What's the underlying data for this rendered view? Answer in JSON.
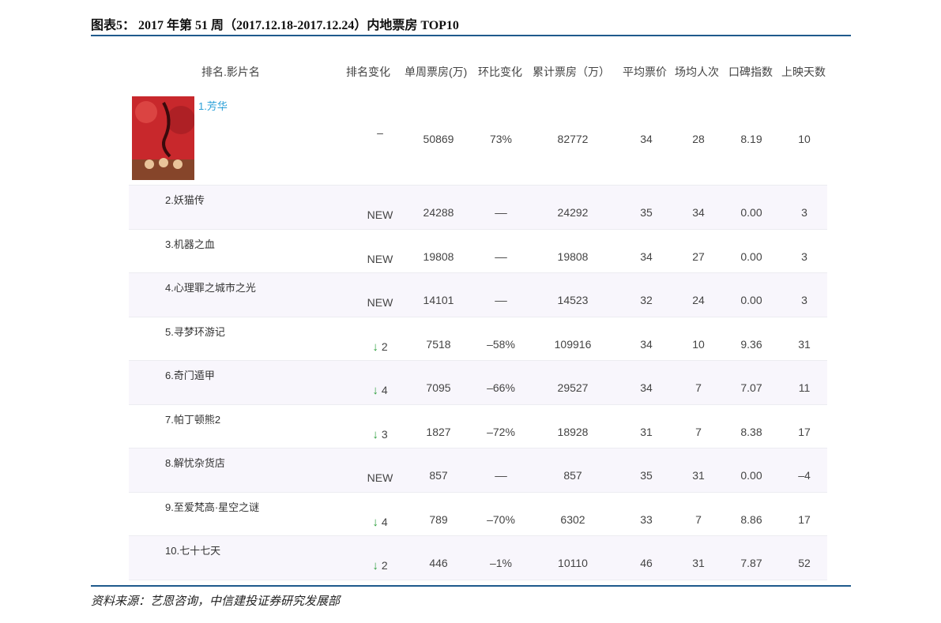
{
  "figure": {
    "title": "图表5：  2017 年第 51 周（2017.12.18-2017.12.24）内地票房 TOP10",
    "source": "资料来源：艺恩咨询，中信建投证券研究发展部"
  },
  "table": {
    "headers": [
      "排名.影片名",
      "排名变化",
      "单周票房(万)",
      "环比变化",
      "累计票房（万）",
      "平均票价",
      "场均人次",
      "口碑指数",
      "上映天数"
    ],
    "rows": [
      {
        "name": "1.芳华",
        "change": "–",
        "change_dir": "",
        "weekly": "50869",
        "wow": "73%",
        "total": "82772",
        "price": "34",
        "per_show": "28",
        "rating": "8.19",
        "days": "10"
      },
      {
        "name": "2.妖猫传",
        "change": "NEW",
        "change_dir": "",
        "weekly": "24288",
        "wow": "––",
        "total": "24292",
        "price": "35",
        "per_show": "34",
        "rating": "0.00",
        "days": "3"
      },
      {
        "name": "3.机器之血",
        "change": "NEW",
        "change_dir": "",
        "weekly": "19808",
        "wow": "––",
        "total": "19808",
        "price": "34",
        "per_show": "27",
        "rating": "0.00",
        "days": "3"
      },
      {
        "name": "4.心理罪之城市之光",
        "change": "NEW",
        "change_dir": "",
        "weekly": "14101",
        "wow": "––",
        "total": "14523",
        "price": "32",
        "per_show": "24",
        "rating": "0.00",
        "days": "3"
      },
      {
        "name": "5.寻梦环游记",
        "change": "2",
        "change_dir": "down",
        "weekly": "7518",
        "wow": "–58%",
        "total": "109916",
        "price": "34",
        "per_show": "10",
        "rating": "9.36",
        "days": "31"
      },
      {
        "name": "6.奇门遁甲",
        "change": "4",
        "change_dir": "down",
        "weekly": "7095",
        "wow": "–66%",
        "total": "29527",
        "price": "34",
        "per_show": "7",
        "rating": "7.07",
        "days": "11"
      },
      {
        "name": "7.帕丁顿熊2",
        "change": "3",
        "change_dir": "down",
        "weekly": "1827",
        "wow": "–72%",
        "total": "18928",
        "price": "31",
        "per_show": "7",
        "rating": "8.38",
        "days": "17"
      },
      {
        "name": "8.解忧杂货店",
        "change": "NEW",
        "change_dir": "",
        "weekly": "857",
        "wow": "––",
        "total": "857",
        "price": "35",
        "per_show": "31",
        "rating": "0.00",
        "days": "–4"
      },
      {
        "name": "9.至爱梵高·星空之谜",
        "change": "4",
        "change_dir": "down",
        "weekly": "789",
        "wow": "–70%",
        "total": "6302",
        "price": "33",
        "per_show": "7",
        "rating": "8.86",
        "days": "17"
      },
      {
        "name": "10.七十七天",
        "change": "2",
        "change_dir": "down",
        "weekly": "446",
        "wow": "–1%",
        "total": "10110",
        "price": "46",
        "per_show": "31",
        "rating": "7.87",
        "days": "52"
      }
    ]
  },
  "icons": {
    "rank_down": "arrow-down-icon"
  },
  "colors": {
    "rule": "#1f5a8c",
    "first_title": "#2aa0d8",
    "rank_down": "#2a9d3a",
    "row_alt": "#f8f6fc",
    "poster_bg": "#c8282c"
  }
}
